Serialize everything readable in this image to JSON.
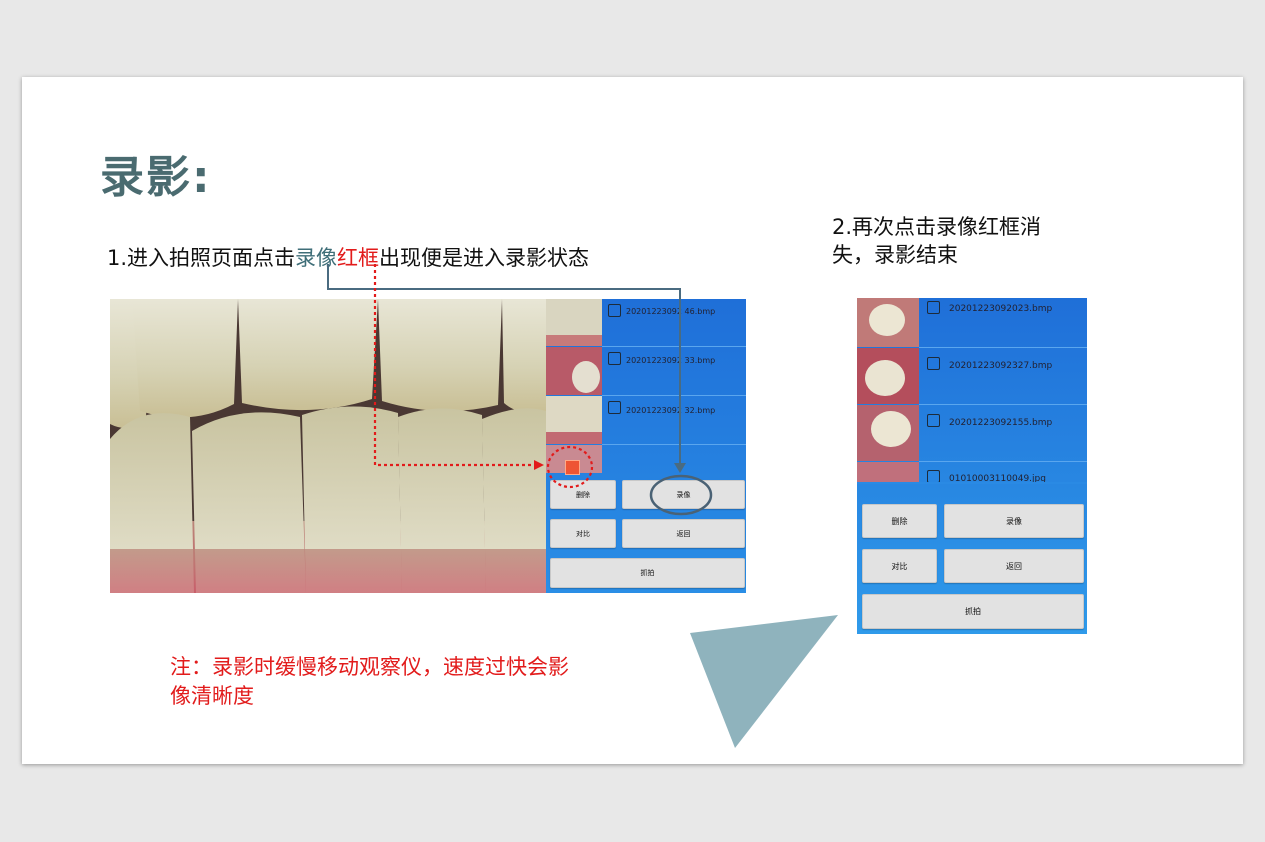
{
  "slide": {
    "title": "录影:",
    "step1": {
      "prefix": "1.进入拍照页面点击",
      "highlight_blue": "录像",
      "highlight_red": "红框",
      "suffix": "出现便是进入录影状态"
    },
    "step2": "2.再次点击录像红框消失，录影结束",
    "note": "注：录影时缓慢移动观察仪，速度过快会影像清晰度"
  },
  "screenshot1": {
    "files": [
      {
        "name": "20201223092146.bmp",
        "shown": "20201223092 46.bmp"
      },
      {
        "name": "20201223092133.bmp",
        "shown": "20201223092 33.bmp"
      },
      {
        "name": "20201223092132.bmp",
        "shown": "20201223092 32.bmp"
      }
    ],
    "buttons": {
      "delete": "删除",
      "record": "录像",
      "compare": "对比",
      "back": "返回",
      "capture": "抓拍"
    }
  },
  "screenshot2": {
    "files": [
      {
        "name": "20201223092023.bmp"
      },
      {
        "name": "20201223092327.bmp"
      },
      {
        "name": "20201223092155.bmp"
      },
      {
        "name": "01010003110049.jpg"
      }
    ],
    "buttons": {
      "delete": "删除",
      "record": "录像",
      "compare": "对比",
      "back": "返回",
      "capture": "抓拍"
    }
  },
  "colors": {
    "title": "#4a6b70",
    "accent_red": "#e21b1b",
    "accent_blue": "#3f6e78",
    "panel_blue": "#1f6fd8",
    "triangle": "#8fb3bd"
  }
}
